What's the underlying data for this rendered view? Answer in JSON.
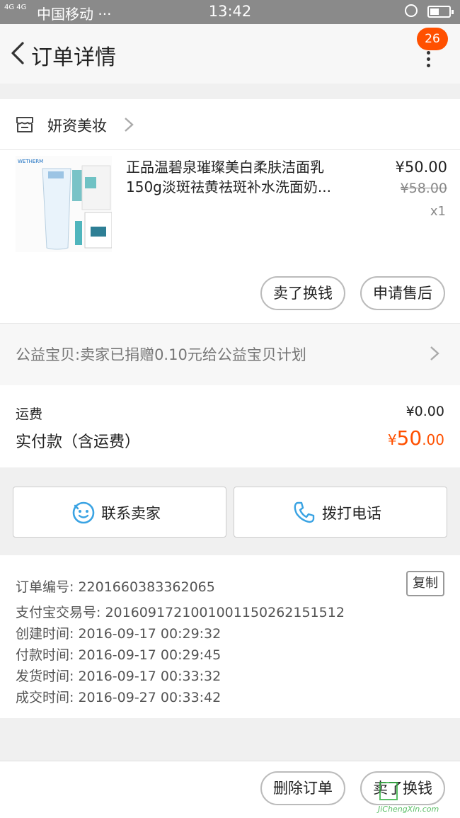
{
  "status_bar": {
    "network": "4G 4G",
    "carrier": "中国移动 ···",
    "time": "13:42"
  },
  "nav": {
    "title": "订单详情",
    "badge_count": "26"
  },
  "shop": {
    "name": "妍资美妆"
  },
  "item": {
    "image_brand": "WETHERM",
    "title": "正品温碧泉璀璨美白柔肤洁面乳150g淡斑祛黄祛斑补水洗面奶...",
    "price": "¥50.00",
    "original_price": "¥58.00",
    "quantity": "x1",
    "sell_button": "卖了换钱",
    "aftersale_button": "申请售后"
  },
  "charity": {
    "text": "公益宝贝:卖家已捐赠0.10元给公益宝贝计划"
  },
  "totals": {
    "shipping_label": "运费",
    "shipping_value": "¥0.00",
    "paid_label": "实付款（含运费）",
    "paid_symbol": "¥",
    "paid_integer": "50",
    "paid_decimal": ".00"
  },
  "contact": {
    "seller_label": "联系卖家",
    "call_label": "拨打电话"
  },
  "order_info": {
    "order_no": "订单编号: 2201660383362065",
    "copy_label": "复制",
    "alipay_no": "支付宝交易号: 2016091721001001150262151512",
    "created": "创建时间: 2016-09-17 00:29:32",
    "paid": "付款时间: 2016-09-17 00:29:45",
    "shipped": "发货时间: 2016-09-17 00:33:32",
    "completed": "成交时间: 2016-09-27 00:33:42"
  },
  "bottom_bar": {
    "delete_label": "删除订单",
    "sell_label": "卖了换钱"
  },
  "watermark": {
    "text": "JiChengXin.com"
  },
  "colors": {
    "accent": "#ff5000",
    "status_bar": "#8a8a8a",
    "contact_icon": "#3aa3e3"
  }
}
